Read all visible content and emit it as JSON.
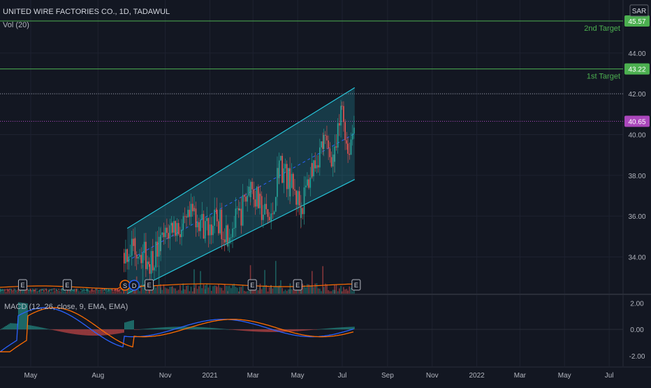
{
  "header": {
    "title": "UNITED WIRE FACTORIES CO., 1D, TADAWUL",
    "volume_label": "Vol (20)",
    "macd_label": "MACD (12, 26, close, 9, EMA, EMA)",
    "currency": "SAR"
  },
  "colors": {
    "background": "#131722",
    "grid": "#1e2230",
    "text": "#b2b5be",
    "up": "#26a69a",
    "down": "#ef5350",
    "channel": "#26c6da",
    "target_line": "#4caf50",
    "price_line": "#ab47bc",
    "macd_line": "#2962ff",
    "signal_line": "#ff6d00",
    "volume_ma": "#ff6d00"
  },
  "chart_data": {
    "type": "candlestick",
    "price_ticks": [
      "44.00",
      "42.00",
      "40.00",
      "38.00",
      "36.00",
      "34.00"
    ],
    "macd_ticks": [
      "2.00",
      "0.00",
      "-2.00"
    ],
    "x_ticks": [
      "May",
      "Aug",
      "Nov",
      "2021",
      "Mar",
      "May",
      "Jul",
      "Sep",
      "Nov",
      "2022",
      "Mar",
      "May",
      "Jul"
    ],
    "ylim": [
      32.2,
      46.6
    ],
    "macd_ylim": [
      -2.8,
      2.6
    ],
    "last_price": "40.65",
    "levels": [
      {
        "name": "2nd Target",
        "label": "2nd Target",
        "price": "45.57"
      },
      {
        "name": "1st Target",
        "label": "1st Target",
        "price": "43.22"
      }
    ],
    "dotted_level": 42.0,
    "earnings_labels": [
      "E",
      "E",
      "E",
      "E",
      "E",
      "E"
    ],
    "dividend_labels": [
      "S",
      "D"
    ],
    "channel": {
      "start_date": "2020-09-10",
      "end_date": "2021-07-18",
      "upper": [
        35.4,
        42.3
      ],
      "lower": [
        32.2,
        37.8
      ]
    },
    "price_series": [
      {
        "date": "2020-09-05",
        "close": 34.2
      },
      {
        "date": "2020-09-20",
        "close": 34.6
      },
      {
        "date": "2020-10-10",
        "close": 33.8
      },
      {
        "date": "2020-10-25",
        "close": 34.6
      },
      {
        "date": "2020-11-10",
        "close": 35.6
      },
      {
        "date": "2020-11-25",
        "close": 35.3
      },
      {
        "date": "2020-12-10",
        "close": 36.2
      },
      {
        "date": "2020-12-25",
        "close": 35.4
      },
      {
        "date": "2021-01-10",
        "close": 35.8
      },
      {
        "date": "2021-01-25",
        "close": 35.2
      },
      {
        "date": "2021-02-10",
        "close": 36.0
      },
      {
        "date": "2021-02-25",
        "close": 37.6
      },
      {
        "date": "2021-03-10",
        "close": 36.4
      },
      {
        "date": "2021-03-25",
        "close": 35.7
      },
      {
        "date": "2021-04-05",
        "close": 38.6
      },
      {
        "date": "2021-04-20",
        "close": 37.6
      },
      {
        "date": "2021-05-05",
        "close": 36.4
      },
      {
        "date": "2021-05-20",
        "close": 38.4
      },
      {
        "date": "2021-06-05",
        "close": 39.6
      },
      {
        "date": "2021-06-20",
        "close": 38.8
      },
      {
        "date": "2021-06-30",
        "close": 41.4
      },
      {
        "date": "2021-07-08",
        "close": 39.2
      },
      {
        "date": "2021-07-18",
        "close": 40.65
      }
    ]
  }
}
